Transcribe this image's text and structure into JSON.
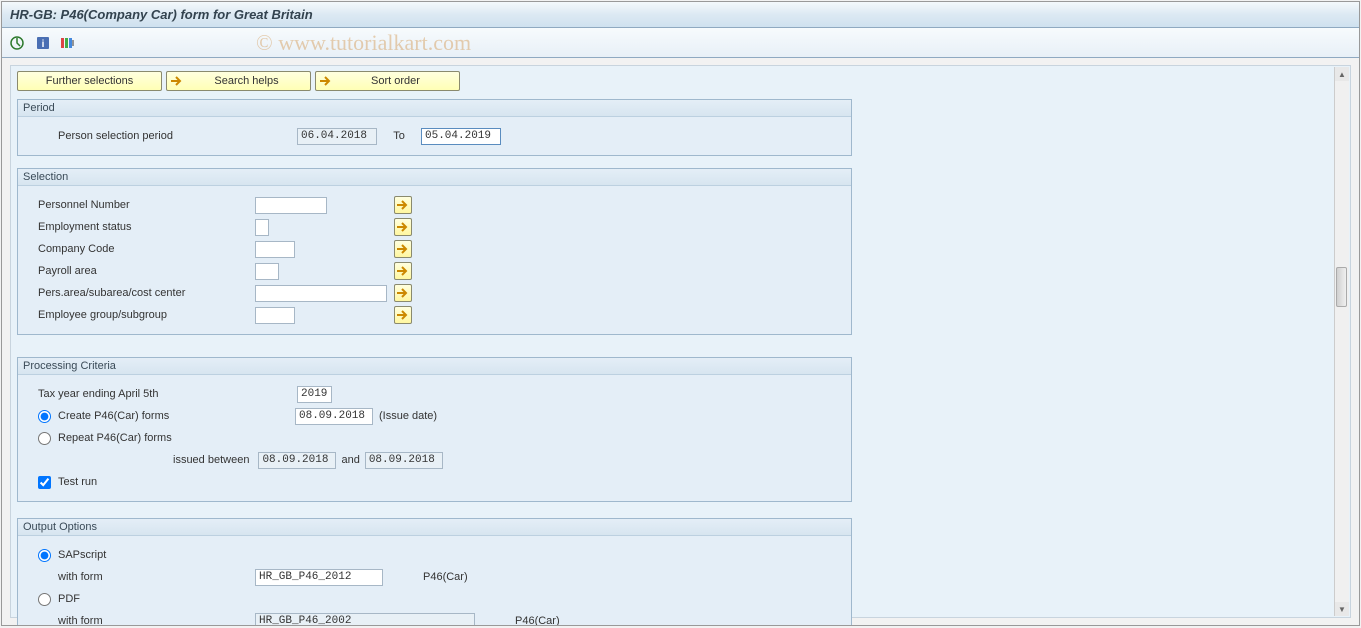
{
  "title": "HR-GB: P46(Company Car) form for Great Britain",
  "watermark": "© www.tutorialkart.com",
  "buttons": {
    "further_selections": "Further selections",
    "search_helps": "Search helps",
    "sort_order": "Sort order"
  },
  "period": {
    "title": "Period",
    "person_selection_label": "Person selection period",
    "from_value": "06.04.2018",
    "to_label": "To",
    "to_value": "05.04.2019"
  },
  "selection": {
    "title": "Selection",
    "personnel_number": "Personnel Number",
    "employment_status": "Employment status",
    "company_code": "Company Code",
    "payroll_area": "Payroll area",
    "pers_area": "Pers.area/subarea/cost center",
    "employee_group": "Employee group/subgroup"
  },
  "processing": {
    "title": "Processing Criteria",
    "tax_year_label": "Tax year ending April 5th",
    "tax_year_value": "2019",
    "create_label": "Create P46(Car) forms",
    "create_date": "08.09.2018",
    "issue_date_label": "(Issue date)",
    "repeat_label": "Repeat P46(Car) forms",
    "issued_between_label": "issued  between",
    "between_from": "08.09.2018",
    "and_label": "and",
    "between_to": "08.09.2018",
    "test_run_label": "Test run"
  },
  "output": {
    "title": "Output Options",
    "sapscript_label": "SAPscript",
    "with_form_label": "with form",
    "form1_value": "HR_GB_P46_2012",
    "form1_suffix": "P46(Car)",
    "pdf_label": "PDF",
    "form2_value": "HR_GB_P46_2002",
    "form2_suffix": "P46(Car)"
  }
}
